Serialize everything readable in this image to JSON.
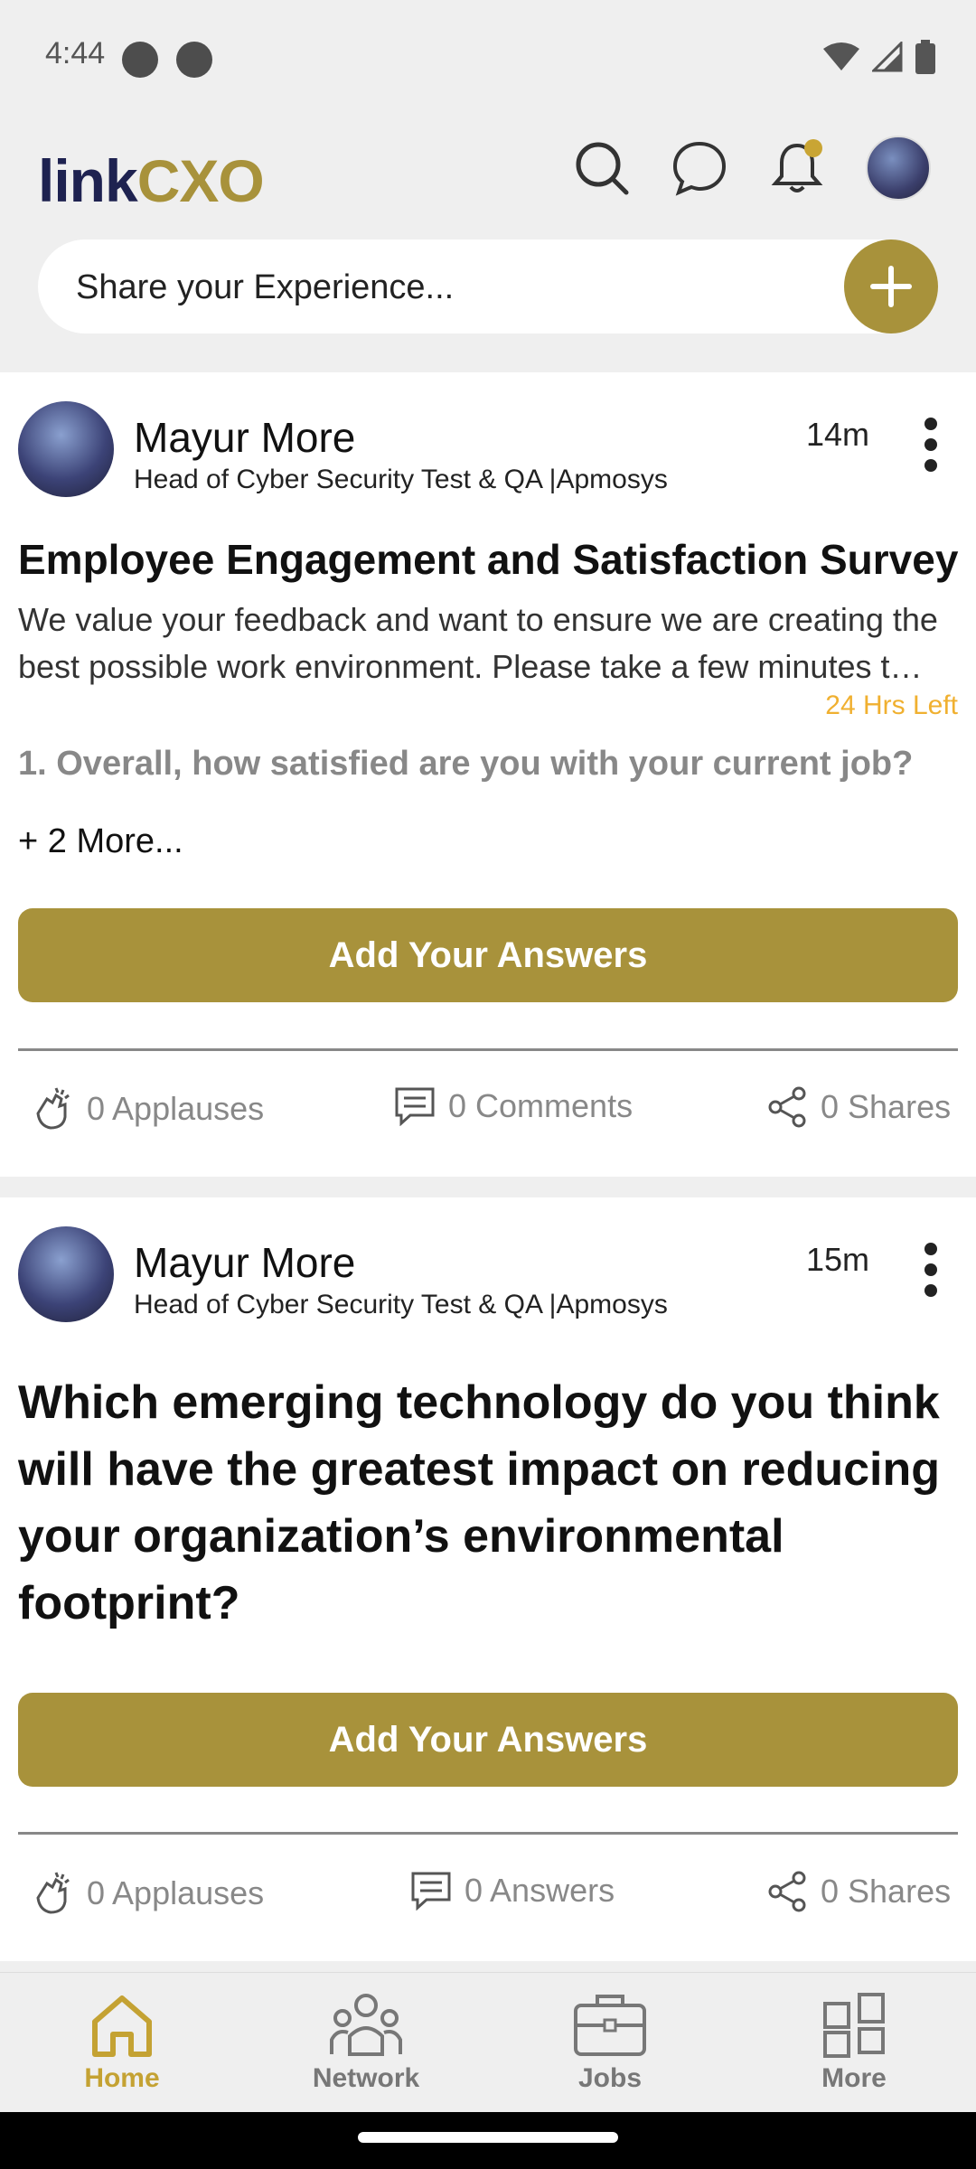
{
  "status_bar": {
    "time": "4:44"
  },
  "header": {
    "logo_left": "link",
    "logo_right": "CXO",
    "share_placeholder": "Share your Experience..."
  },
  "posts": [
    {
      "author": "Mayur More",
      "subtitle": "Head of Cyber Security Test & QA |Apmosys",
      "time": "14m",
      "title": "Employee Engagement and Satisfaction Survey",
      "description": "We value your feedback and want to ensure we are creating the best possible work environment. Please take a few minutes t…",
      "time_left": "24 Hrs Left",
      "question": "1. Overall, how satisfied are you with your current job?",
      "more": "+ 2 More...",
      "button": "Add Your Answers",
      "applauses": "0 Applauses",
      "comments": "0 Comments",
      "shares": "0 Shares"
    },
    {
      "author": "Mayur More",
      "subtitle": "Head of Cyber Security Test & QA |Apmosys",
      "time": "15m",
      "question_title": "Which emerging technology do you think will have the greatest impact on reducing your organization’s environmental footprint?",
      "button": "Add Your Answers",
      "applauses": "0 Applauses",
      "answers": "0 Answers",
      "shares": "0 Shares"
    }
  ],
  "bottom_nav": {
    "items": [
      {
        "label": "Home",
        "icon": "home-icon",
        "active": true
      },
      {
        "label": "Network",
        "icon": "network-icon",
        "active": false
      },
      {
        "label": "Jobs",
        "icon": "briefcase-icon",
        "active": false
      },
      {
        "label": "More",
        "icon": "grid-icon",
        "active": false
      }
    ]
  },
  "colors": {
    "brand_gold": "#a8923b",
    "brand_navy": "#1e2250",
    "deadline": "#f0b030"
  }
}
